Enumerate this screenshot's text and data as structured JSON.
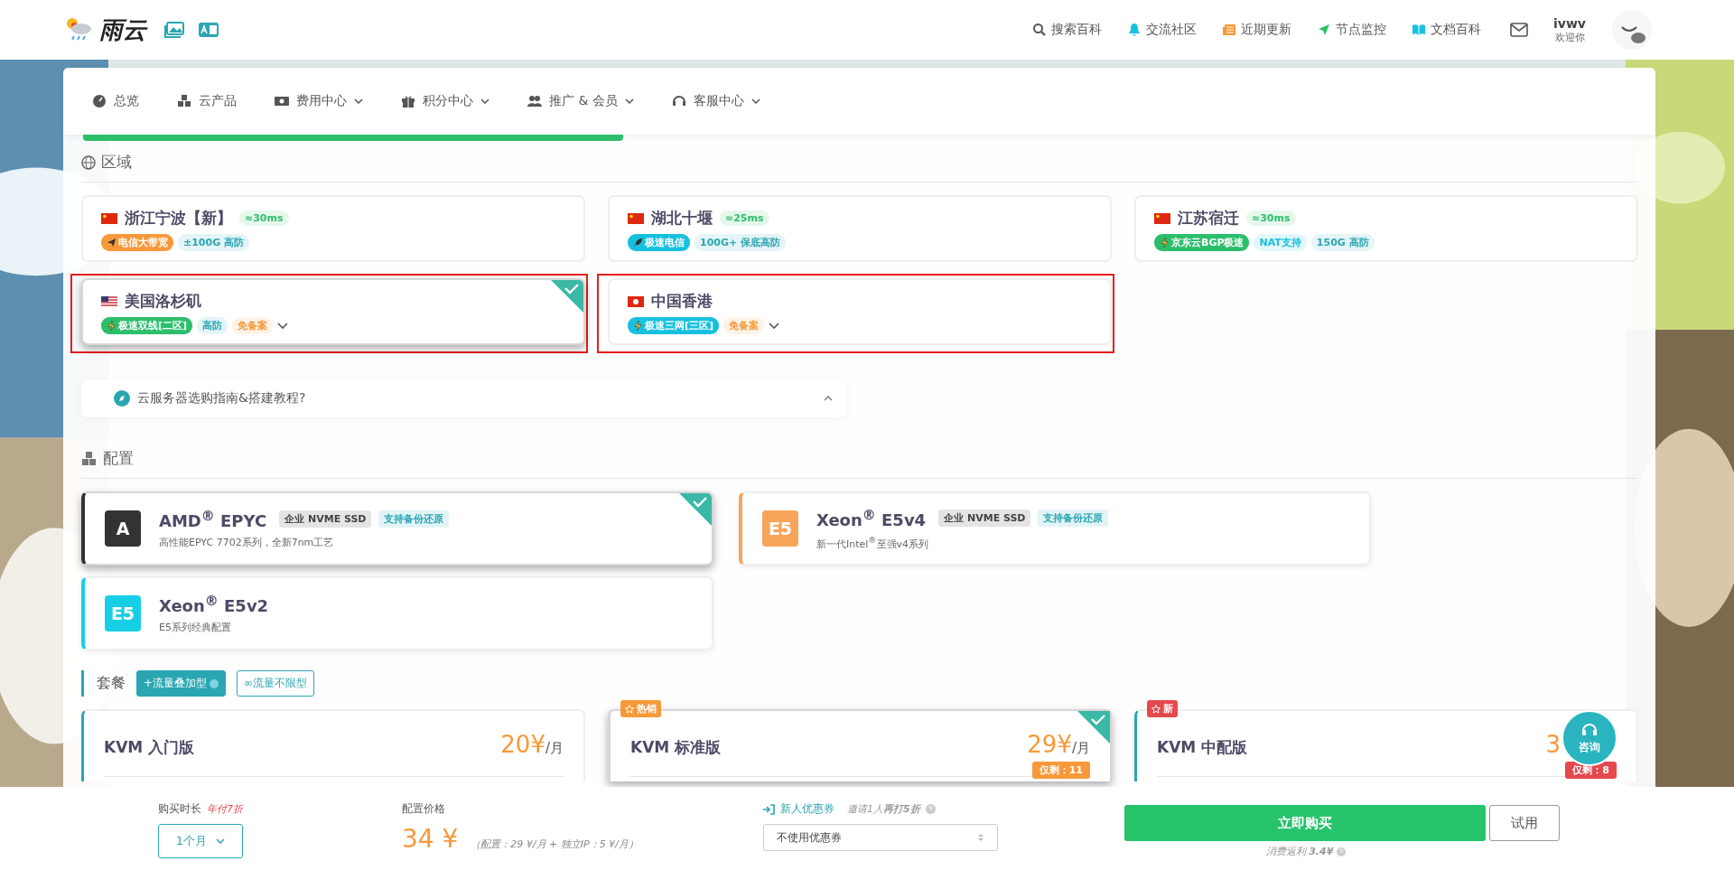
{
  "header": {
    "logo": "雨云",
    "links": [
      {
        "label": "搜索百科"
      },
      {
        "label": "交流社区"
      },
      {
        "label": "近期更新"
      },
      {
        "label": "节点监控"
      },
      {
        "label": "文档百科"
      }
    ],
    "user": {
      "name": "ivwv",
      "greeting": "欢迎你"
    }
  },
  "nav": [
    {
      "label": "总览",
      "dropdown": false
    },
    {
      "label": "云产品",
      "dropdown": false
    },
    {
      "label": "费用中心",
      "dropdown": true
    },
    {
      "label": "积分中心",
      "dropdown": true
    },
    {
      "label": "推广 & 会员",
      "dropdown": true
    },
    {
      "label": "客服中心",
      "dropdown": true
    }
  ],
  "region_section": {
    "title": "区域",
    "regions": [
      {
        "name": "浙江宁波【新】",
        "ping": "≈30ms",
        "tags": [
          {
            "text": "电信大带宽",
            "kind": "solid",
            "color": "#f7993a"
          },
          {
            "text": "±100G 高防",
            "kind": "soft",
            "color": "#2aa6b3"
          }
        ],
        "selected": false,
        "highlighted": false
      },
      {
        "name": "湖北十堰",
        "ping": "≈25ms",
        "tags": [
          {
            "text": "极速电信",
            "kind": "solid",
            "color": "#17c1de"
          },
          {
            "text": "100G+ 保底高防",
            "kind": "soft",
            "color": "#2aa6b3"
          }
        ],
        "selected": false,
        "highlighted": false
      },
      {
        "name": "江苏宿迁",
        "ping": "≈30ms",
        "tags": [
          {
            "text": "京东云BGP极速",
            "kind": "solid",
            "color": "#2dbe6c"
          },
          {
            "text": "NAT支持",
            "kind": "soft",
            "color": "#17c1de"
          },
          {
            "text": "150G 高防",
            "kind": "soft",
            "color": "#2aa6b3"
          }
        ],
        "selected": false,
        "highlighted": false
      },
      {
        "name": "美国洛杉矶",
        "tags": [
          {
            "text": "极速双线[二区]",
            "kind": "solid",
            "color": "#2dbe6c"
          },
          {
            "text": "高防",
            "kind": "soft",
            "color": "#2aa6b3"
          },
          {
            "text": "免备案",
            "kind": "soft",
            "color": "#f7993a"
          }
        ],
        "expanded": false,
        "selected": true,
        "highlighted": true
      },
      {
        "name": "中国香港",
        "tags": [
          {
            "text": "极速三网[三区]",
            "kind": "solid",
            "color": "#17c1de"
          },
          {
            "text": "免备案",
            "kind": "soft",
            "color": "#f7993a"
          }
        ],
        "expanded": false,
        "selected": false,
        "highlighted": true
      }
    ],
    "guide": {
      "text": "云服务器选购指南&搭建教程?",
      "expanded": true
    }
  },
  "config_section": {
    "title": "配置",
    "cpus": [
      {
        "badge": "A",
        "color": "#333333",
        "name": "AMD$^{®}$ EPYC",
        "tags": [
          {
            "text": "企业 NVME SSD",
            "kind": "gray"
          },
          {
            "text": "支持备份还原",
            "kind": "teal"
          }
        ],
        "desc": "高性能EPYC 7702系列，全新7nm工艺",
        "selected": true
      },
      {
        "badge": "E5",
        "color": "#f7a55a",
        "name": "Xeon$^{®}$ E5v4",
        "tags": [
          {
            "text": "企业 NVME SSD",
            "kind": "gray"
          },
          {
            "text": "支持备份还原",
            "kind": "teal"
          }
        ],
        "desc": "新一代Intel$^{®}$至强v4系列",
        "selected": false
      },
      {
        "badge": "E5",
        "color": "#17cfe4",
        "name": "Xeon$^{®}$ E5v2",
        "desc": "E5系列经典配置",
        "selected": false
      }
    ]
  },
  "package_section": {
    "title": "套餐",
    "types": [
      {
        "label": "+流量叠加型",
        "selected": true
      },
      {
        "label": "∞流量不限型",
        "selected": false
      }
    ],
    "plans": [
      {
        "name": "KVM 入门版",
        "price": "20¥",
        "unit": "/月",
        "selected": false
      },
      {
        "name": "KVM 标准版",
        "badge": "热销",
        "color": "#f7993a",
        "price": "29¥",
        "unit": "/月",
        "stock": "仅剩：11",
        "selected": true
      },
      {
        "name": "KVM 中配版",
        "badge": "新",
        "color": "#e5484d",
        "price": "3",
        "stock": "仅剩：8",
        "selected": false
      }
    ]
  },
  "consult": "咨询",
  "bottom_bar": {
    "duration": {
      "label": "购买时长",
      "note": "年付7折",
      "value": "1个月"
    },
    "price": {
      "label": "配置价格",
      "value": "34 ¥",
      "detail": "（配置：29 ¥/月 + 独立IP：5 ¥/月）"
    },
    "coupon": {
      "label": "新人优惠券",
      "invite": "邀请1人**再打5折**",
      "value": "不使用优惠券"
    },
    "buy": "立即购买",
    "trial": "试用",
    "rebate": "消费返利 **3.4¥**"
  }
}
